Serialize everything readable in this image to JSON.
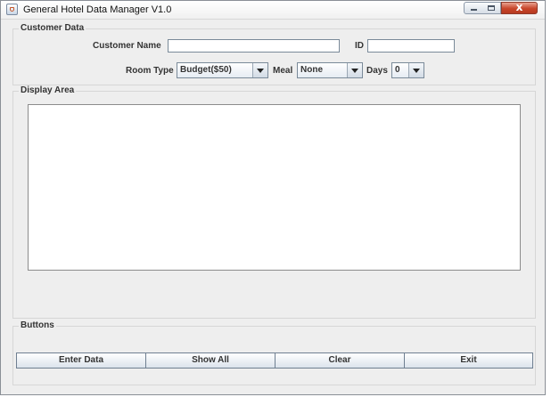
{
  "window": {
    "title": "General Hotel Data Manager V1.0",
    "close_glyph": "x",
    "icons": [
      "java-app-icon",
      "minimize-icon",
      "maximize-icon",
      "close-icon"
    ]
  },
  "customer_data": {
    "legend": "Customer Data",
    "name_label": "Customer Name",
    "name_value": "",
    "id_label": "ID",
    "id_value": "",
    "room_type_label": "Room Type",
    "room_type_value": "Budget($50)",
    "meal_label": "Meal",
    "meal_value": "None",
    "days_label": "Days",
    "days_value": "0"
  },
  "display": {
    "legend": "Display Area",
    "content": ""
  },
  "buttons": {
    "legend": "Buttons",
    "enter_data": "Enter Data",
    "show_all": "Show All",
    "clear": "Clear",
    "exit": "Exit"
  }
}
